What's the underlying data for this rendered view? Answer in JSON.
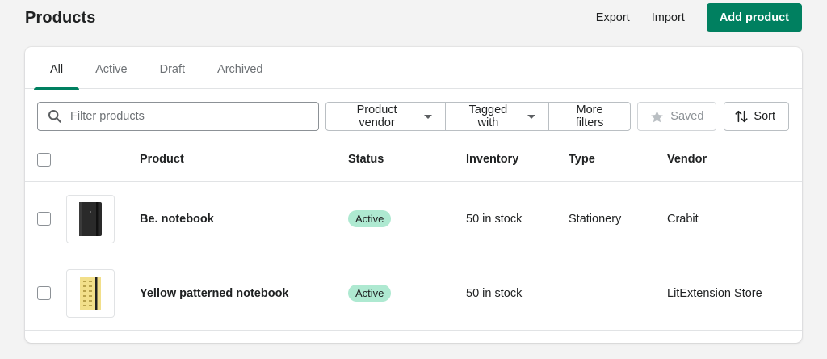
{
  "page": {
    "title": "Products"
  },
  "header": {
    "export_label": "Export",
    "import_label": "Import",
    "add_product_label": "Add product"
  },
  "tabs": [
    {
      "label": "All",
      "active": true
    },
    {
      "label": "Active",
      "active": false
    },
    {
      "label": "Draft",
      "active": false
    },
    {
      "label": "Archived",
      "active": false
    }
  ],
  "filters": {
    "search_placeholder": "Filter products",
    "product_vendor_label": "Product vendor",
    "tagged_with_label": "Tagged with",
    "more_filters_label": "More filters",
    "saved_label": "Saved",
    "sort_label": "Sort"
  },
  "table": {
    "headers": {
      "product": "Product",
      "status": "Status",
      "inventory": "Inventory",
      "type": "Type",
      "vendor": "Vendor"
    },
    "rows": [
      {
        "name": "Be. notebook",
        "status": "Active",
        "inventory": "50 in stock",
        "type": "Stationery",
        "vendor": "Crabit",
        "thumbnail": "black-notebook-image"
      },
      {
        "name": "Yellow patterned notebook",
        "status": "Active",
        "inventory": "50 in stock",
        "type": "",
        "vendor": "LitExtension Store",
        "thumbnail": "yellow-notebook-image"
      }
    ]
  },
  "colors": {
    "primary": "#008060",
    "active_badge": "#aee9d1",
    "page_bg": "#f3f3f3"
  }
}
